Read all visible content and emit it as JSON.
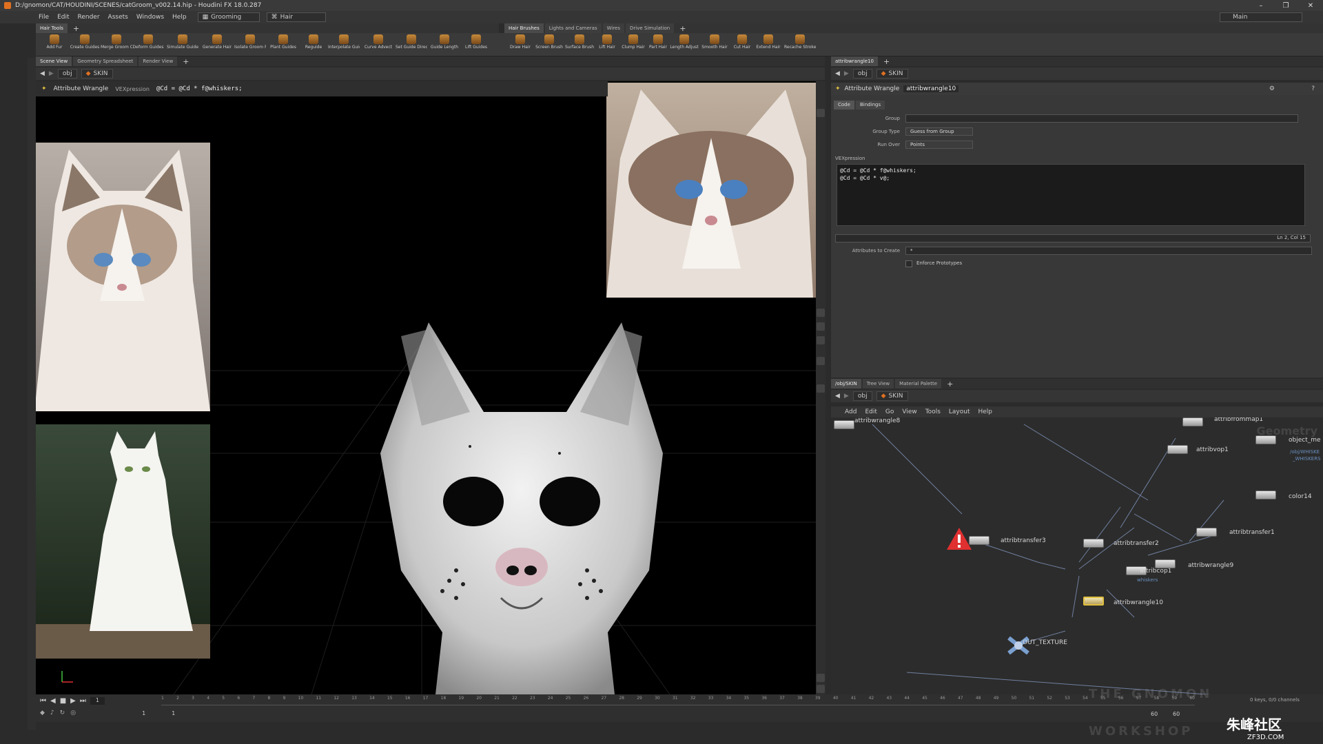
{
  "title_bar": {
    "path": "D:/gnomon/CAT/HOUDINI/SCENES/catGroom_v002.14.hip - Houdini FX 18.0.287"
  },
  "menu": {
    "items": [
      "File",
      "Edit",
      "Render",
      "Assets",
      "Windows",
      "Help"
    ],
    "desktop": "Grooming",
    "context": "Hair",
    "main_desktop": "Main"
  },
  "shelf": {
    "left_tab": "Hair Tools",
    "right_tabs": [
      "Hair Brushes",
      "Lights and Cameras",
      "Wires",
      "Drive Simulation"
    ],
    "left_tools": [
      "Add Fur",
      "Create Guides",
      "Merge Groom Objects",
      "Deform Guides",
      "Simulate Guides",
      "Generate Hair",
      "Isolate Groom Parts",
      "Plant Guides",
      "Reguide",
      "Interpolate Guides",
      "Curve Advect",
      "Set Guide Direction",
      "Guide Length",
      "Lift Guides"
    ],
    "right_tools": [
      "Draw Hair",
      "Screen Brush",
      "Surface Brush",
      "Lift Hair",
      "Clump Hair",
      "Part Hair",
      "Length Adjust",
      "Smooth Hair",
      "Cut Hair",
      "Extend Hair",
      "Recache Strokes"
    ]
  },
  "viewer": {
    "tabs": [
      "Scene View",
      "Geometry Spreadsheet",
      "Render View"
    ],
    "path_obj": "obj",
    "path_node": "SKIN",
    "op_name": "Attribute Wrangle",
    "op_mode": "VEXpression",
    "op_expr": "@Cd = @Cd * f@whiskers;"
  },
  "params": {
    "tab": "attribwrangle10",
    "path_obj": "obj",
    "path_node": "SKIN",
    "node_type": "Attribute Wrangle",
    "node_name": "attribwrangle10",
    "subtabs": [
      "Code",
      "Bindings"
    ],
    "group_label": "Group",
    "group_value": "",
    "group_type_label": "Group Type",
    "group_type_value": "Guess from Group",
    "run_over_label": "Run Over",
    "run_over_value": "Points",
    "vex_label": "VEXpression",
    "vex_line1": "@Cd = @Cd * f@whiskers;",
    "vex_line2": "@Cd = @Cd * v@;",
    "cursor_pos": "Ln 2, Col 15",
    "attrs_label": "Attributes to Create",
    "attrs_value": "*",
    "enforce_label": "Enforce Prototypes"
  },
  "network": {
    "tabs": [
      "/obj/SKIN",
      "Tree View",
      "Material Palette"
    ],
    "path_obj": "obj",
    "path_node": "SKIN",
    "menu": [
      "Add",
      "Edit",
      "Go",
      "View",
      "Tools",
      "Layout",
      "Help"
    ],
    "context_label": "Geometry",
    "nodes": {
      "n1": "attribwrangle8",
      "n2": "attribfrommap1",
      "n3": "attribvop1",
      "n4": "object_me",
      "n5": "/obj/WHISKE",
      "n6": "_WHISKERS",
      "n7": "color14",
      "n8": "attribtransfer3",
      "n9": "attribtransfer2",
      "n10": "attribtransfer1",
      "n11": "attribcop1",
      "n12": "whiskers",
      "n13": "attribwrangle9",
      "n14": "attribwrangle10",
      "n15": "OUT_TEXTURE"
    }
  },
  "timeline": {
    "current_frame": "1",
    "start": "1",
    "start2": "1",
    "end": "60",
    "end2": "60",
    "keys": "0 keys, 0/0 channels",
    "ticks": [
      "1",
      "2",
      "3",
      "4",
      "5",
      "6",
      "7",
      "8",
      "9",
      "10",
      "11",
      "12",
      "13",
      "14",
      "15",
      "16",
      "17",
      "18",
      "19",
      "20",
      "21",
      "22",
      "23",
      "24",
      "25",
      "26",
      "27",
      "28",
      "29",
      "30",
      "31",
      "32",
      "33",
      "34",
      "35",
      "36",
      "37",
      "38",
      "39",
      "40",
      "41",
      "42",
      "43",
      "44",
      "45",
      "46",
      "47",
      "48",
      "49",
      "50",
      "51",
      "52",
      "53",
      "54",
      "55",
      "56",
      "57",
      "58",
      "59",
      "60"
    ]
  },
  "watermark": {
    "brand": "THE GNOMON WORKSHOP",
    "site_cn": "朱峰社区",
    "site_url": "ZF3D.COM"
  },
  "colors": {
    "accent": "#e07020",
    "viewport_bg": "#000000",
    "node_flag": "#e0c040",
    "error": "#e03030"
  }
}
